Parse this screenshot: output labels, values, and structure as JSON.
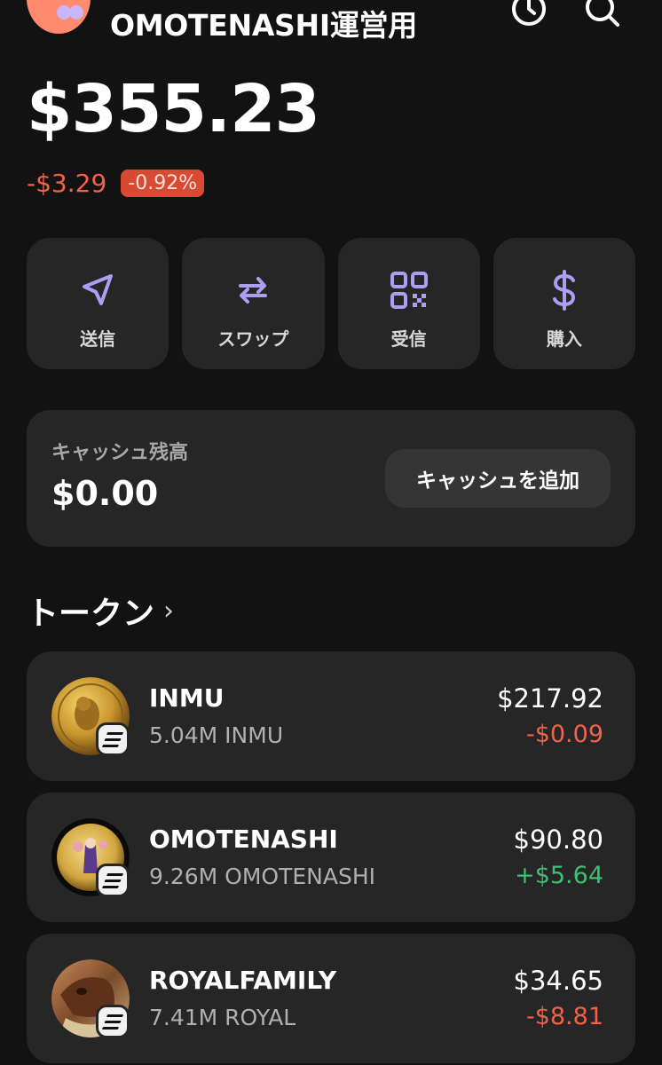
{
  "header": {
    "account_name": "OMOTENASHI運営用",
    "icons": [
      "history-icon",
      "search-icon"
    ]
  },
  "portfolio": {
    "balance": "$355.23",
    "change_abs": "-$3.29",
    "change_pct": "-0.92%"
  },
  "actions": [
    {
      "label": "送信",
      "icon": "send-icon"
    },
    {
      "label": "スワップ",
      "icon": "swap-icon"
    },
    {
      "label": "受信",
      "icon": "qr-code-icon"
    },
    {
      "label": "購入",
      "icon": "dollar-icon"
    }
  ],
  "cash": {
    "label": "キャッシュ残高",
    "value": "$0.00",
    "add_button": "キャッシュを追加"
  },
  "tokens_section": {
    "title": "トークン",
    "items": [
      {
        "name": "INMU",
        "amount": "5.04M INMU",
        "value": "$217.92",
        "change": "-$0.09",
        "direction": "down"
      },
      {
        "name": "OMOTENASHI",
        "amount": "9.26M OMOTENASHI",
        "value": "$90.80",
        "change": "+$5.64",
        "direction": "up"
      },
      {
        "name": "ROYALFAMILY",
        "amount": "7.41M ROYAL",
        "value": "$34.65",
        "change": "-$8.81",
        "direction": "down"
      }
    ]
  },
  "colors": {
    "accent": "#ab9ff2",
    "negative": "#f2624a",
    "positive": "#3fbf72",
    "card": "#262626",
    "background": "#121212"
  }
}
